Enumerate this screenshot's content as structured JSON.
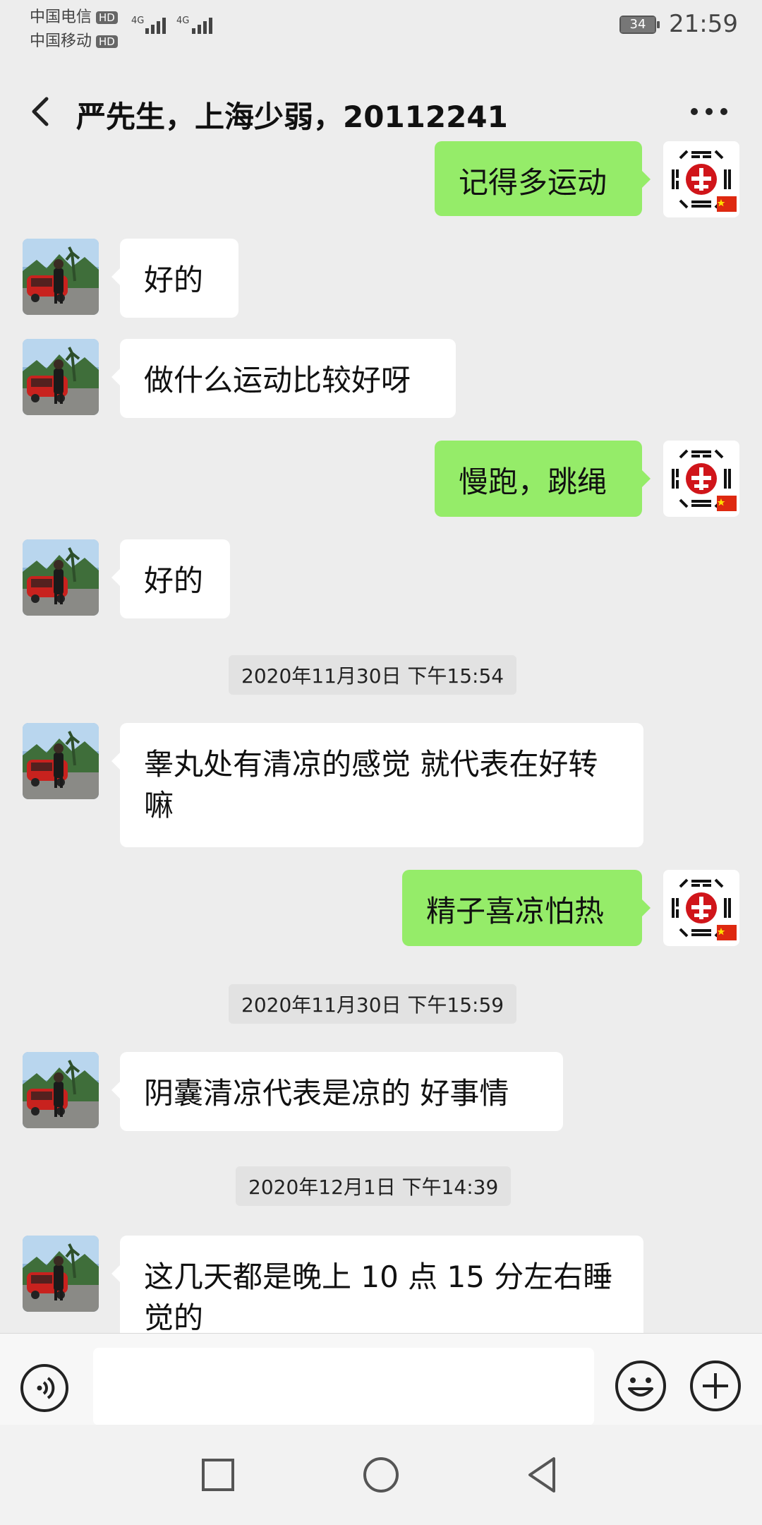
{
  "status_bar": {
    "carrier1": "中国电信",
    "carrier2": "中国移动",
    "hd_label": "HD",
    "network1": "4G",
    "network2": "4G",
    "battery": "34",
    "time": "21:59"
  },
  "header": {
    "title": "严先生，上海少弱，20112241"
  },
  "messages": [
    {
      "side": "out",
      "text": "记得多运动"
    },
    {
      "side": "in",
      "text": "好的"
    },
    {
      "side": "in",
      "text": "做什么运动比较好呀"
    },
    {
      "side": "out",
      "text": "慢跑，跳绳"
    },
    {
      "side": "in",
      "text": "好的"
    },
    {
      "side": "in",
      "text": "睾丸处有清凉的感觉 就代表在好转嘛"
    },
    {
      "side": "out",
      "text": "精子喜凉怕热"
    },
    {
      "side": "in",
      "text": "阴囊清凉代表是凉的 好事情"
    },
    {
      "side": "in",
      "text": "这几天都是晚上 10 点 15 分左右睡觉的"
    }
  ],
  "timestamps": [
    "2020年11月30日 下午15:54",
    "2020年11月30日 下午15:59",
    "2020年12月1日 下午14:39"
  ],
  "input": {
    "placeholder": ""
  },
  "colors": {
    "background": "#ededed",
    "outgoing_bubble": "#95ec69",
    "incoming_bubble": "#ffffff"
  },
  "icons": [
    "back-arrow-icon",
    "more-icon",
    "voice-icon",
    "emoji-icon",
    "plus-icon",
    "nav-recent-icon",
    "nav-home-icon",
    "nav-back-icon"
  ]
}
